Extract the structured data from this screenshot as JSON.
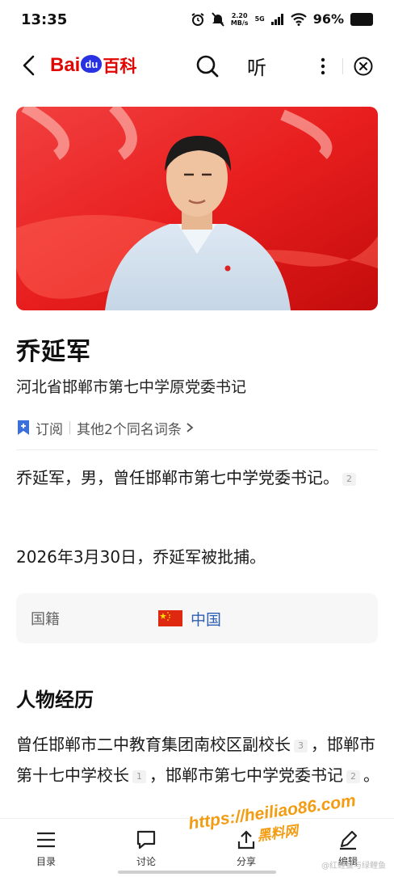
{
  "status": {
    "time": "13:35",
    "net_speed_value": "2.20",
    "net_speed_unit": "MB/s",
    "network": "5G",
    "battery": "96%"
  },
  "nav": {
    "logo_bai": "Bai",
    "logo_du": "du",
    "logo_baike": "百科",
    "listen_label": "听"
  },
  "hero": {
    "icon": "person-photo"
  },
  "entry": {
    "title": "乔延军",
    "subtitle": "河北省邯郸市第七中学原党委书记",
    "subscribe_label": "订阅",
    "same_name_link": "其他2个同名词条"
  },
  "summary": {
    "text": "乔延军，男，曾任邯郸市第七中学党委书记。",
    "cite": "2",
    "arrest_note": "2026年3月30日，乔延军被批捕。"
  },
  "info": {
    "label": "国籍",
    "value": "中国",
    "flag_color": "#de2910"
  },
  "experience": {
    "title": "人物经历",
    "seg1": "曾任邯郸市二中教育集团南校区副校长",
    "cite1": "3",
    "seg2": "，邯郸市第十七中学校长",
    "cite2": "1",
    "seg3": "，邯郸市第七中学党委书记",
    "cite3": "2",
    "seg4": "。"
  },
  "bottom": {
    "toc": "目录",
    "discuss": "讨论",
    "share": "分享",
    "edit": "编辑"
  },
  "watermark": {
    "line1": "https://heiliao86.com",
    "line2": "黑料网"
  },
  "weibo_mark": "@红鲤鱼与绿鲤鱼"
}
